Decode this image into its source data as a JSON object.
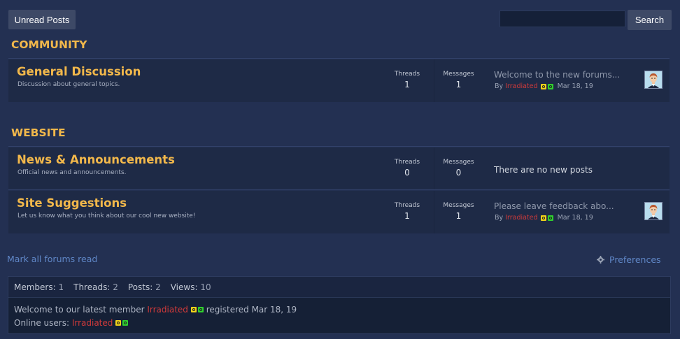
{
  "toolbar": {
    "unread_label": "Unread Posts",
    "search_value": "",
    "search_label": "Search"
  },
  "categories": [
    {
      "title": "COMMUNITY",
      "forums": [
        {
          "name": "General Discussion",
          "description": "Discussion about general topics.",
          "threads_label": "Threads",
          "threads": "1",
          "messages_label": "Messages",
          "messages": "1",
          "last_post_title": "Welcome to the new forums...",
          "by_label": "By",
          "last_post_user": "Irradiated",
          "last_post_date": "Mar 18, 19"
        }
      ]
    },
    {
      "title": "WEBSITE",
      "forums": [
        {
          "name": "News & Announcements",
          "description": "Official news and announcements.",
          "threads_label": "Threads",
          "threads": "0",
          "messages_label": "Messages",
          "messages": "0",
          "no_posts": "There are no new posts"
        },
        {
          "name": "Site Suggestions",
          "description": "Let us know what you think about our cool new website!",
          "threads_label": "Threads",
          "threads": "1",
          "messages_label": "Messages",
          "messages": "1",
          "last_post_title": "Please leave feedback abo...",
          "by_label": "By",
          "last_post_user": "Irradiated",
          "last_post_date": "Mar 18, 19"
        }
      ]
    }
  ],
  "footer": {
    "mark_read": "Mark all forums read",
    "preferences": "Preferences"
  },
  "stats": {
    "members_label": "Members:",
    "members": "1",
    "threads_label": "Threads:",
    "threads": "2",
    "posts_label": "Posts:",
    "posts": "2",
    "views_label": "Views:",
    "views": "10",
    "welcome_text": "Welcome to our latest member",
    "latest_member": "Irradiated",
    "registered_text": "registered Mar 18, 19",
    "online_label": "Online users:",
    "online_user": "Irradiated"
  },
  "colors": {
    "background": "#233052",
    "row_bg": "#1e2a46",
    "accent": "#f2b84b",
    "username": "#d03a3a",
    "link": "#5f86c6"
  },
  "icons": [
    "avatar-icon",
    "gear-icon",
    "user-badge-yellow",
    "user-badge-green"
  ]
}
